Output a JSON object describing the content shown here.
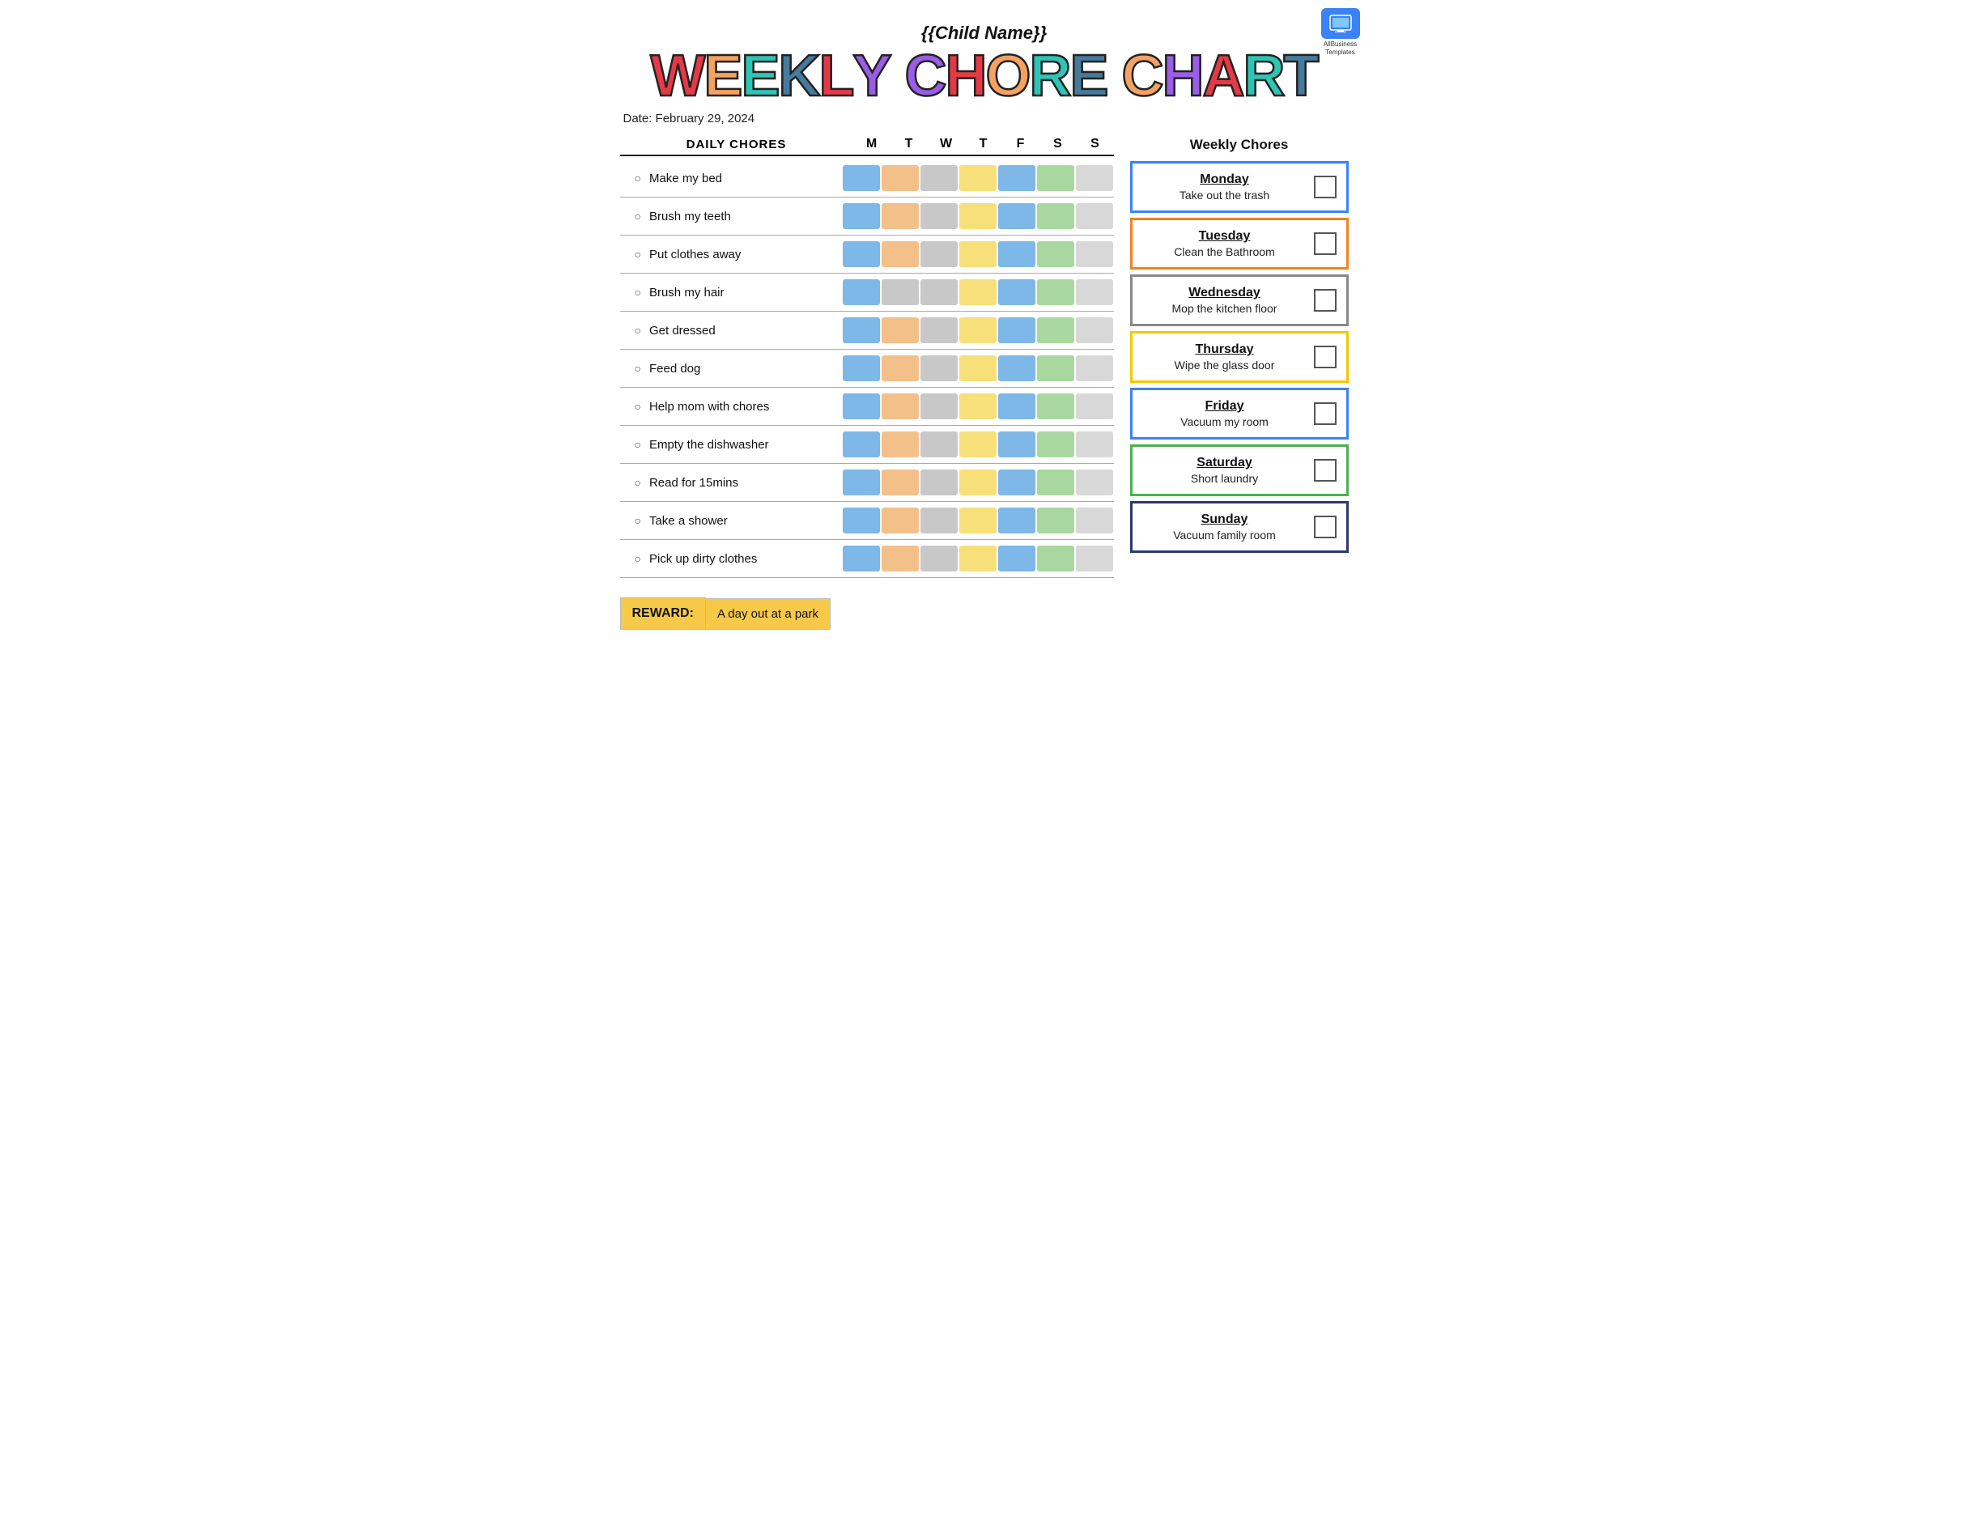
{
  "logo": {
    "line1": "AllBusiness",
    "line2": "Templates"
  },
  "child_name": "{{Child Name}}",
  "title": {
    "word1": [
      "W",
      "E",
      "E",
      "K",
      "L",
      "Y"
    ],
    "word2": [
      "C",
      "H",
      "O",
      "R",
      "E"
    ],
    "word3": [
      "C",
      "H",
      "A",
      "R",
      "T"
    ]
  },
  "date_label": "Date:",
  "date_value": "February 29, 2024",
  "table": {
    "header_chores": "DAILY CHORES",
    "days": [
      "M",
      "T",
      "W",
      "T",
      "F",
      "S",
      "S"
    ]
  },
  "chores": [
    "Make my bed",
    "Brush my teeth",
    "Put clothes away",
    "Brush my hair",
    "Get dressed",
    "Feed dog",
    "Help mom with chores",
    "Empty the dishwasher",
    "Read for 15mins",
    "Take a shower",
    "Pick up dirty clothes"
  ],
  "reward": {
    "label": "REWARD:",
    "text": "A day out at a park"
  },
  "weekly_header": "Weekly Chores",
  "weekly_chores": [
    {
      "day": "Monday",
      "chore": "Take out the trash",
      "border": "border-blue"
    },
    {
      "day": "Tuesday",
      "chore": "Clean the Bathroom",
      "border": "border-orange"
    },
    {
      "day": "Wednesday",
      "chore": "Mop the kitchen floor",
      "border": "border-gray"
    },
    {
      "day": "Thursday",
      "chore": "Wipe the glass door",
      "border": "border-yellow"
    },
    {
      "day": "Friday",
      "chore": "Vacuum my room",
      "border": "border-blue"
    },
    {
      "day": "Saturday",
      "chore": "Short laundry",
      "border": "border-green"
    },
    {
      "day": "Sunday",
      "chore": "Vacuum family room",
      "border": "border-dark"
    }
  ]
}
